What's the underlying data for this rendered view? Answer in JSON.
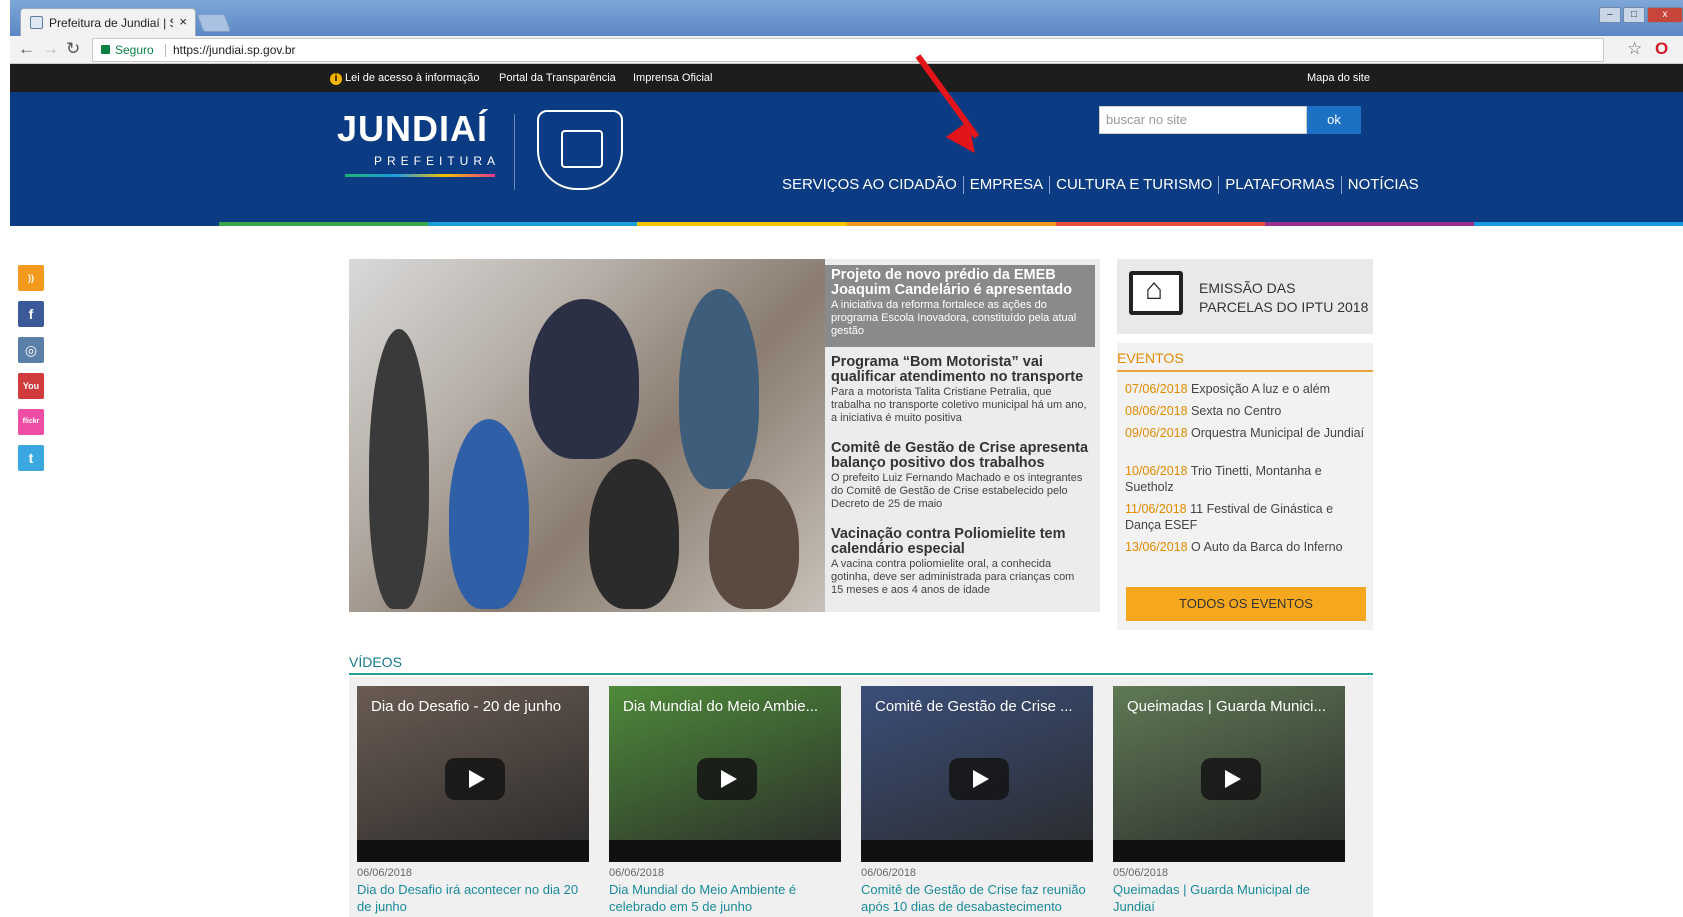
{
  "browser": {
    "tab_title": "Prefeitura de Jundiaí | Sit",
    "tab_close": "×",
    "secure_label": "Seguro",
    "url": "https://jundiai.sp.gov.br"
  },
  "topbar": {
    "info_icon": "i",
    "links": [
      "Lei de acesso à informação",
      "Portal da Transparência",
      "Imprensa Oficial"
    ],
    "sitemap": "Mapa do site"
  },
  "header": {
    "logo_main": "JUNDIAÍ",
    "logo_sub": "PREFEITURA",
    "search_placeholder": "buscar no site",
    "search_button": "ok",
    "menu": [
      "SERVIÇOS AO CIDADÃO",
      "EMPRESA",
      "CULTURA E TURISMO",
      "PLATAFORMAS",
      "NOTÍCIAS"
    ]
  },
  "colorbar": [
    "#0b3c83",
    "#3aa64a",
    "#1aa0d8",
    "#f5c400",
    "#f39a1e",
    "#e94e3b",
    "#9b2f8e",
    "#1a9be0"
  ],
  "social": [
    {
      "name": "rss-icon",
      "glyph": "))",
      "color": "#f39a1e"
    },
    {
      "name": "facebook-icon",
      "glyph": "f",
      "color": "#3b5998"
    },
    {
      "name": "instagram-icon",
      "glyph": "◎",
      "color": "#5a7fa8"
    },
    {
      "name": "youtube-icon",
      "glyph": "You",
      "color": "#d23b3b"
    },
    {
      "name": "flickr-icon",
      "glyph": "flickr",
      "color": "#f04ea6"
    },
    {
      "name": "twitter-icon",
      "glyph": "t",
      "color": "#3aa7e0"
    }
  ],
  "featured": {
    "items": [
      {
        "title": "Projeto de novo prédio da EMEB Joaquim Candelário é apresentado",
        "desc": "A iniciativa da reforma fortalece as ações do programa Escola Inovadora, constituído pela atual gestão"
      },
      {
        "title": "Programa “Bom Motorista” vai qualificar atendimento no transporte",
        "desc": "Para a motorista Talita Cristiane Petralia, que trabalha no transporte coletivo municipal há um ano, a iniciativa é muito positiva"
      },
      {
        "title": "Comitê de Gestão de Crise apresenta balanço positivo dos trabalhos",
        "desc": "O prefeito Luiz Fernando Machado e os integrantes do Comitê de Gestão de Crise estabelecido pelo Decreto de 25 de maio"
      },
      {
        "title": "Vacinação contra Poliomielite tem calendário especial",
        "desc": "A vacina contra poliomielite oral, a conhecida gotinha, deve ser administrada para crianças com 15 meses e aos 4 anos de idade"
      }
    ]
  },
  "iptu": {
    "label": "EMISSÃO DAS PARCELAS DO IPTU 2018"
  },
  "events": {
    "heading": "EVENTOS",
    "items": [
      {
        "date": "07/06/2018",
        "text": "Exposição A luz e o além"
      },
      {
        "date": "08/06/2018",
        "text": "Sexta no Centro"
      },
      {
        "date": "09/06/2018",
        "text": "Orquestra Municipal de Jundiaí"
      },
      {
        "date": "10/06/2018",
        "text": "Trio Tinetti, Montanha e Suetholz"
      },
      {
        "date": "11/06/2018",
        "text": "11 Festival de Ginástica e Dança ESEF"
      },
      {
        "date": "13/06/2018",
        "text": "O Auto da Barca do Inferno"
      }
    ],
    "all_button": "TODOS OS EVENTOS"
  },
  "videos": {
    "heading": "VÍDEOS",
    "items": [
      {
        "thumb_title": "Dia do Desafio - 20 de junho",
        "date": "06/06/2018",
        "caption": "Dia do Desafio irá acontecer no dia 20 de junho",
        "color": "#6a5b52"
      },
      {
        "thumb_title": "Dia Mundial do Meio Ambie...",
        "date": "06/06/2018",
        "caption": "Dia Mundial do Meio Ambiente é celebrado em 5 de junho",
        "color": "#4e8a3a"
      },
      {
        "thumb_title": "Comitê de Gestão de Crise ...",
        "date": "06/06/2018",
        "caption": "Comitê de Gestão de Crise faz reunião após 10 dias de desabastecimento",
        "color": "#3b4f7a"
      },
      {
        "thumb_title": "Queimadas | Guarda Munici...",
        "date": "05/06/2018",
        "caption": "Queimadas | Guarda Municipal de Jundiaí",
        "color": "#5f7a55"
      }
    ]
  }
}
